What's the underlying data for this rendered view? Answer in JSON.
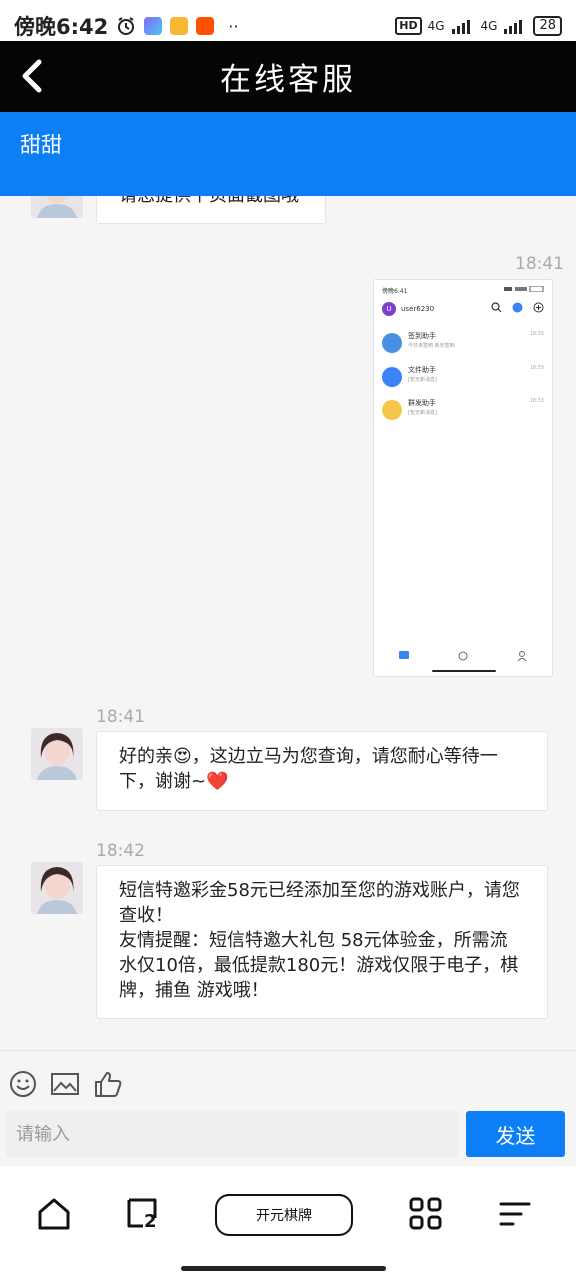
{
  "status_bar": {
    "time": "傍晚6:42",
    "more": "··",
    "hd": "HD",
    "network": "4G",
    "battery": "28"
  },
  "header": {
    "title": "在线客服",
    "back_icon": "chevron-left-icon"
  },
  "agent": {
    "name": "甜甜"
  },
  "chat": {
    "partial_message": "请您提供下页面截图哦",
    "image_message": {
      "time": "18:41",
      "screenshot": {
        "status_time": "傍晚6:41",
        "user_initial": "U",
        "user_name": "user6230",
        "rows": [
          {
            "title": "签到助手",
            "subtitle": "今日未签到·新年签到",
            "time": "18:33",
            "color": "#4a90e2"
          },
          {
            "title": "文件助手",
            "subtitle": "[暂无新消息]",
            "time": "18:33",
            "color": "#3b82f6"
          },
          {
            "title": "群发助手",
            "subtitle": "[暂无新消息]",
            "time": "18:33",
            "color": "#f5c64a"
          }
        ]
      }
    },
    "messages": [
      {
        "time": "18:41",
        "text": "好的亲😍，这边立马为您查询，请您耐心等待一下，谢谢~❤️"
      },
      {
        "time": "18:42",
        "text": "短信特邀彩金58元已经添加至您的游戏账户，请您查收！\n友情提醒：短信特邀大礼包 58元体验金，所需流水仅10倍，最低提款180元！游戏仅限于电子，棋牌，捕鱼 游戏哦！"
      }
    ]
  },
  "input": {
    "placeholder": "请输入",
    "send_label": "发送",
    "tools": [
      "emoji-icon",
      "image-icon",
      "thumbs-up-icon"
    ]
  },
  "bottom_nav": {
    "center_label": "开元棋牌",
    "icons": [
      "home-icon",
      "tabs-icon",
      "apps-icon",
      "menu-icon"
    ],
    "tab_count": "2"
  }
}
